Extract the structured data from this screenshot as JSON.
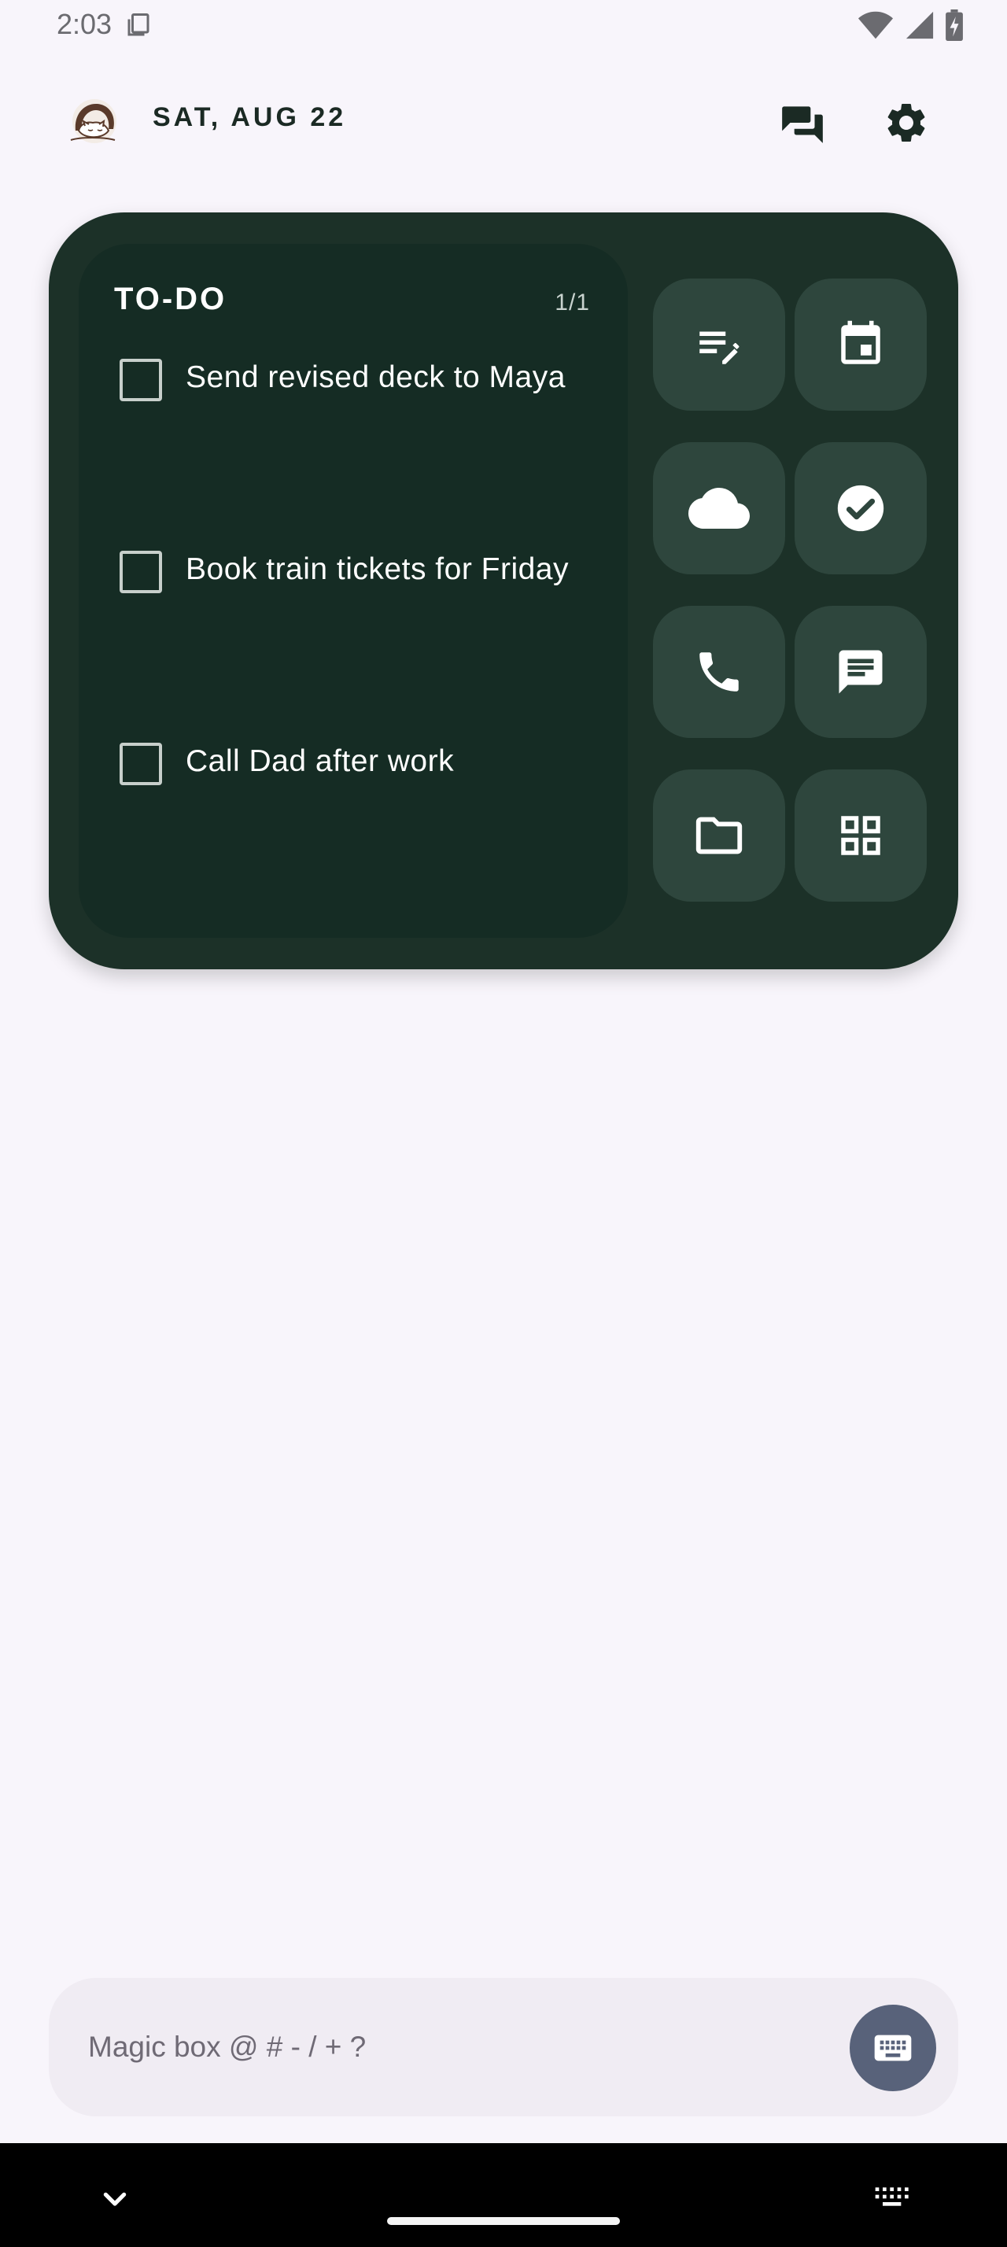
{
  "status_bar": {
    "time": "2:03",
    "icons": [
      "copy-icon",
      "wifi-icon",
      "signal-icon",
      "battery-charging-icon"
    ]
  },
  "header": {
    "date": "SAT, AUG 22",
    "avatar_icon": "cat-avatar-icon",
    "chat_icon": "chat-bubbles-icon",
    "settings_icon": "gear-icon"
  },
  "todo": {
    "title": "TO-DO",
    "page_indicator": "1/1",
    "items": [
      {
        "text": "Send revised deck to Maya",
        "checked": false
      },
      {
        "text": "Book train tickets for Friday",
        "checked": false
      },
      {
        "text": "Call Dad after work",
        "checked": false
      }
    ]
  },
  "shortcuts": [
    {
      "icon": "notes-icon"
    },
    {
      "icon": "calendar-icon"
    },
    {
      "icon": "cloud-icon"
    },
    {
      "icon": "check-circle-icon"
    },
    {
      "icon": "phone-icon"
    },
    {
      "icon": "message-icon"
    },
    {
      "icon": "folder-icon"
    },
    {
      "icon": "apps-grid-icon"
    }
  ],
  "magic_box": {
    "placeholder": "Magic box @ # - / + ?",
    "keyboard_icon": "keyboard-icon"
  },
  "colors": {
    "background": "#f8f5fb",
    "widget": "#1c3128",
    "todo_panel": "#152c24",
    "tile": "#2e463d",
    "keyboard_button": "#58627a"
  }
}
